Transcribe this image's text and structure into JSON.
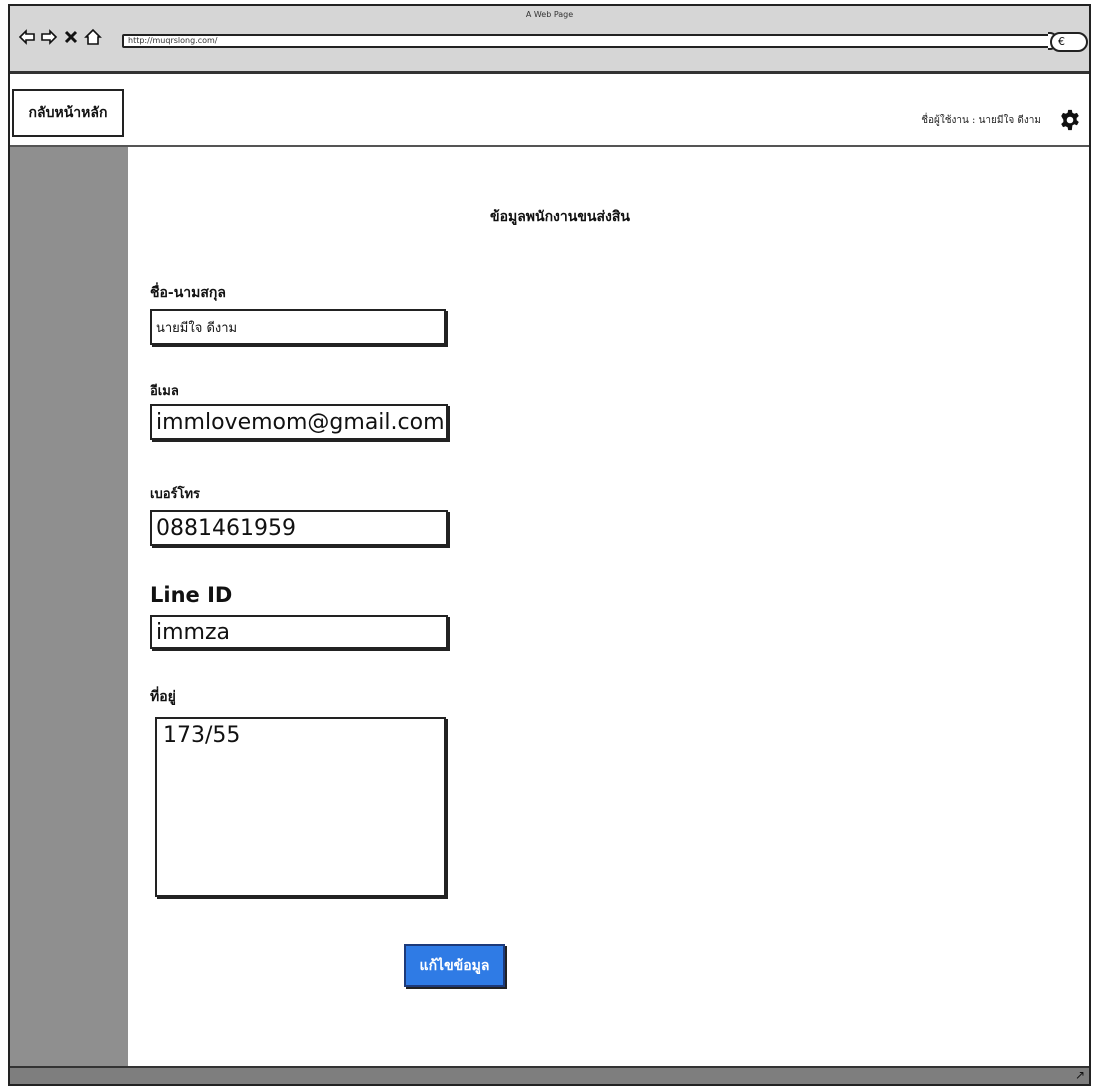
{
  "browser": {
    "window_title": "A Web Page",
    "url": "http://muqrslong.com/",
    "icons": [
      "back-icon",
      "forward-icon",
      "close-icon",
      "home-icon",
      "search-icon"
    ]
  },
  "header": {
    "home_button": "กลับหน้าหลัก",
    "user_label": "ชื่อผู้ใช้งาน : นายมีใจ ดีงาม",
    "settings_icon": "gear-icon"
  },
  "form": {
    "title": "ข้อมูลพนักงานขนส่งสิน",
    "name": {
      "label": "ชื่อ-นามสกุล",
      "value": "นายมีใจ ดีงาม"
    },
    "email": {
      "label": "อีเมล",
      "value": "immlovemom@gmail.com"
    },
    "phone": {
      "label": "เบอร์โทร",
      "value": "0881461959"
    },
    "line_id": {
      "label": "Line ID",
      "value": "immza"
    },
    "address": {
      "label": "ที่อยู่",
      "value": "173/55"
    },
    "edit_button": "แก้ไขข้อมูล"
  },
  "colors": {
    "sidebar": "#8f8f8f",
    "chrome": "#d6d6d6",
    "button": "#2f7be5"
  }
}
